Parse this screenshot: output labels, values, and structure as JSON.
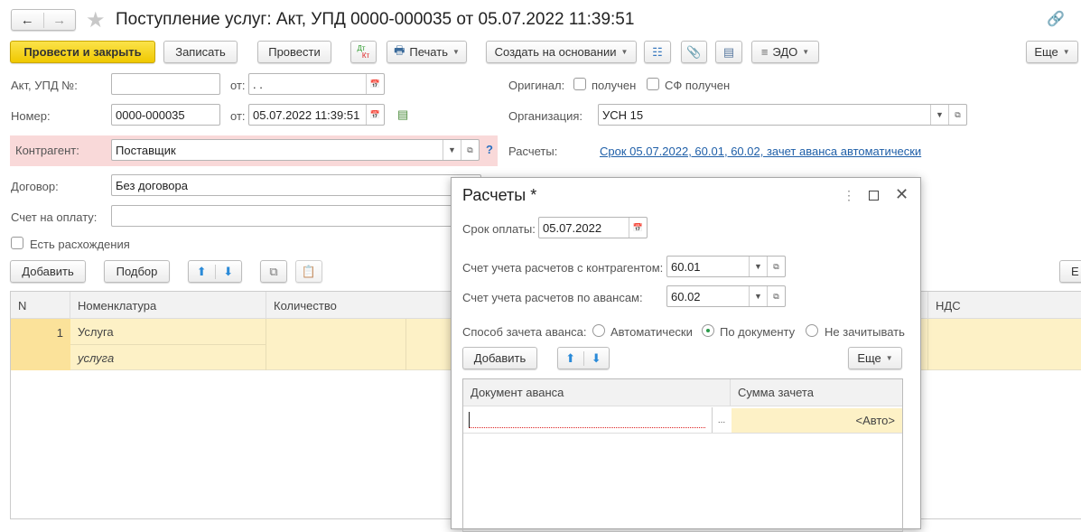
{
  "window": {
    "title": "Поступление услуг: Акт, УПД 0000-000035 от 05.07.2022 11:39:51"
  },
  "toolbar": {
    "post_close": "Провести и закрыть",
    "save": "Записать",
    "post": "Провести",
    "dtkt_dt": "Дт",
    "dtkt_kt": "Кт",
    "print": "Печать",
    "create_based": "Создать на основании",
    "edo": "ЭДО",
    "more": "Еще"
  },
  "form": {
    "act_label": "Акт, УПД №:",
    "act_value": "",
    "from_label": "от:",
    "act_date": " .  .",
    "number_label": "Номер:",
    "number_value": "0000-000035",
    "number_date": "05.07.2022 11:39:51",
    "original_label": "Оригинал:",
    "received": "получен",
    "sf_received": "СФ получен",
    "org_label": "Организация:",
    "org_value": "УСН 15",
    "counterparty_label": "Контрагент:",
    "counterparty_value": "Поставщик",
    "help": "?",
    "settlements_label": "Расчеты:",
    "settlements_link": "Срок 05.07.2022, 60.01, 60.02, зачет аванса автоматически",
    "contract_label": "Договор:",
    "contract_value": "Без договора",
    "invoice_label": "Счет на оплату:",
    "invoice_value": "",
    "discrepancy_label": "Есть расхождения"
  },
  "table_toolbar": {
    "add": "Добавить",
    "pick": "Подбор",
    "more_partial": "Е"
  },
  "table": {
    "columns": [
      "N",
      "Номенклатура",
      "Количество",
      "НДС"
    ],
    "rows": [
      {
        "n": "1",
        "item": "Услуга",
        "item_sub": "услуга"
      }
    ]
  },
  "dialog": {
    "title": "Расчеты *",
    "due_label": "Срок оплаты:",
    "due_value": "05.07.2022",
    "acc_cp_label": "Счет учета расчетов с контрагентом:",
    "acc_cp_value": "60.01",
    "acc_adv_label": "Счет учета расчетов по авансам:",
    "acc_adv_value": "60.02",
    "offset_label": "Способ зачета аванса:",
    "offset_options": [
      "Автоматически",
      "По документу",
      "Не зачитывать"
    ],
    "offset_selected": "По документу",
    "add": "Добавить",
    "more": "Еще",
    "columns": [
      "Документ аванса",
      "Сумма зачета"
    ],
    "rows": [
      {
        "doc": "",
        "dots": "...",
        "sum": "<Авто>"
      }
    ]
  },
  "colors": {
    "accent_yellow": "#f5d313",
    "row_highlight": "#fdf1c6",
    "error_bg": "#f9d9d9",
    "link": "#1f5fa8"
  }
}
